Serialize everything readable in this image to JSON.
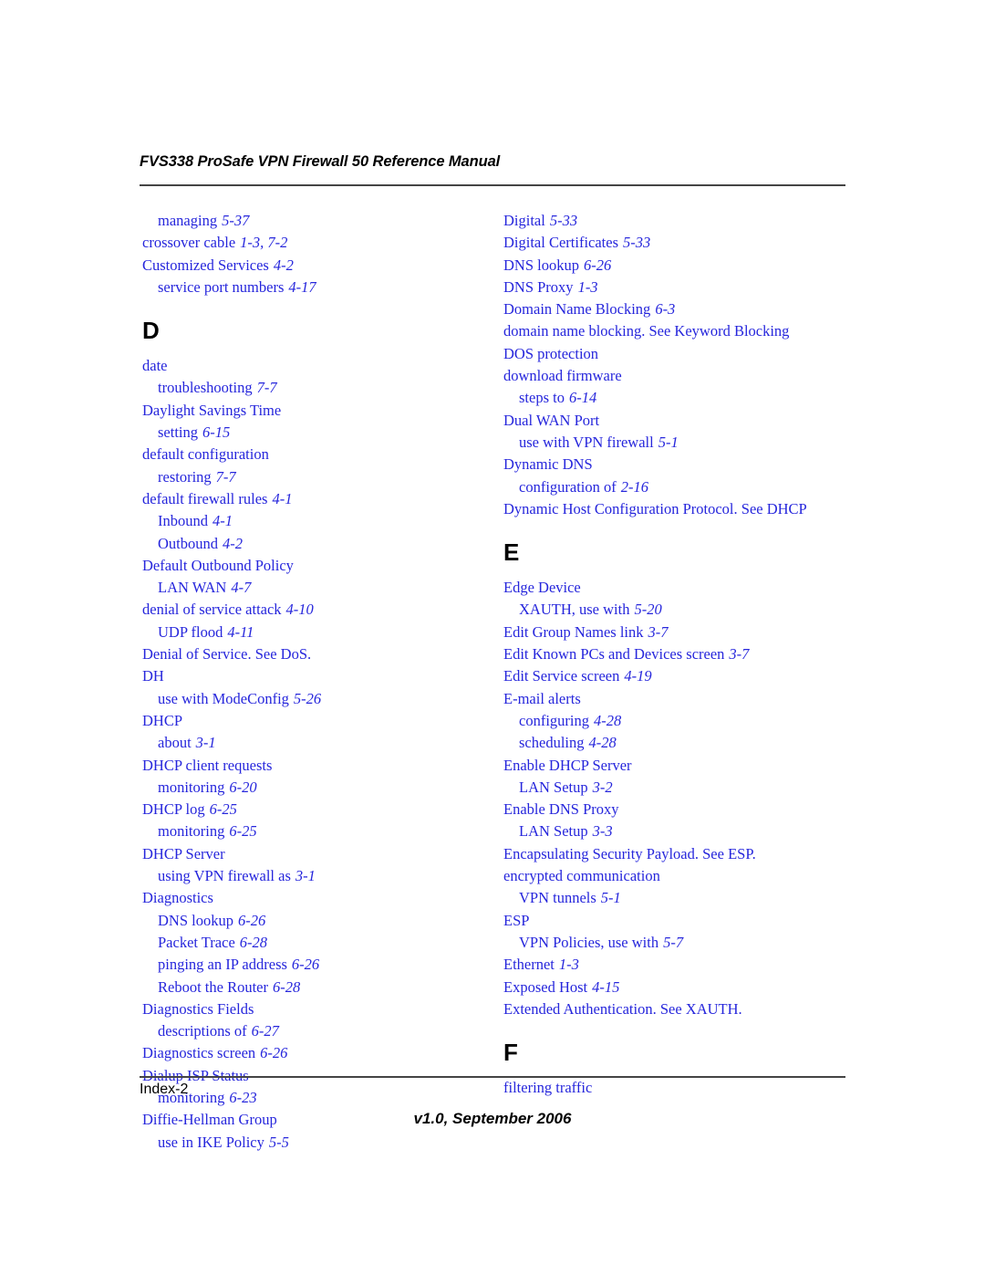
{
  "header": {
    "title": "FVS338 ProSafe VPN Firewall 50 Reference Manual"
  },
  "footer": {
    "folio": "Index-2",
    "version": "v1.0, September 2006"
  },
  "colors": {
    "entry_blue": "#2626DC",
    "rule": "#444444",
    "heading_black": "#000000"
  },
  "columns": [
    {
      "id": "left",
      "blocks": [
        {
          "type": "entries",
          "items": [
            {
              "level": 1,
              "term": "managing",
              "loc": "5-37"
            },
            {
              "level": 0,
              "term": "crossover cable",
              "loc": "1-3, 7-2"
            },
            {
              "level": 0,
              "term": "Customized Services",
              "loc": "4-2"
            },
            {
              "level": 1,
              "term": "service port numbers",
              "loc": "4-17"
            }
          ]
        },
        {
          "type": "alpha",
          "letter": "D"
        },
        {
          "type": "entries",
          "items": [
            {
              "level": 0,
              "term": "date",
              "loc": ""
            },
            {
              "level": 1,
              "term": "troubleshooting",
              "loc": "7-7"
            },
            {
              "level": 0,
              "term": "Daylight Savings Time",
              "loc": ""
            },
            {
              "level": 1,
              "term": "setting",
              "loc": "6-15"
            },
            {
              "level": 0,
              "term": "default configuration",
              "loc": ""
            },
            {
              "level": 1,
              "term": "restoring",
              "loc": "7-7"
            },
            {
              "level": 0,
              "term": "default firewall rules",
              "loc": "4-1"
            },
            {
              "level": 1,
              "term": "Inbound",
              "loc": "4-1"
            },
            {
              "level": 1,
              "term": "Outbound",
              "loc": "4-2"
            },
            {
              "level": 0,
              "term": "Default Outbound Policy",
              "loc": ""
            },
            {
              "level": 1,
              "term": "LAN WAN",
              "loc": "4-7"
            },
            {
              "level": 0,
              "term": "denial of service attack",
              "loc": "4-10"
            },
            {
              "level": 1,
              "term": "UDP flood",
              "loc": "4-11"
            },
            {
              "level": 0,
              "term": "Denial of Service. See DoS.",
              "loc": ""
            },
            {
              "level": 0,
              "term": "DH",
              "loc": ""
            },
            {
              "level": 1,
              "term": "use with ModeConfig",
              "loc": "5-26"
            },
            {
              "level": 0,
              "term": "DHCP",
              "loc": ""
            },
            {
              "level": 1,
              "term": "about",
              "loc": "3-1"
            },
            {
              "level": 0,
              "term": "DHCP client requests",
              "loc": ""
            },
            {
              "level": 1,
              "term": "monitoring",
              "loc": "6-20"
            },
            {
              "level": 0,
              "term": "DHCP log",
              "loc": "6-25"
            },
            {
              "level": 1,
              "term": "monitoring",
              "loc": "6-25"
            },
            {
              "level": 0,
              "term": "DHCP Server",
              "loc": ""
            },
            {
              "level": 1,
              "term": "using VPN firewall as",
              "loc": "3-1"
            },
            {
              "level": 0,
              "term": "Diagnostics",
              "loc": ""
            },
            {
              "level": 1,
              "term": "DNS lookup",
              "loc": "6-26"
            },
            {
              "level": 1,
              "term": "Packet Trace",
              "loc": "6-28"
            },
            {
              "level": 1,
              "term": "pinging an IP address",
              "loc": "6-26"
            },
            {
              "level": 1,
              "term": "Reboot the Router",
              "loc": "6-28"
            },
            {
              "level": 0,
              "term": "Diagnostics Fields",
              "loc": ""
            },
            {
              "level": 1,
              "term": "descriptions of",
              "loc": "6-27"
            },
            {
              "level": 0,
              "term": "Diagnostics screen",
              "loc": "6-26"
            },
            {
              "level": 0,
              "term": "Dialup ISP Status",
              "loc": ""
            },
            {
              "level": 1,
              "term": "monitoring",
              "loc": "6-23"
            },
            {
              "level": 0,
              "term": "Diffie-Hellman Group",
              "loc": ""
            },
            {
              "level": 1,
              "term": "use in IKE Policy",
              "loc": "5-5"
            }
          ]
        }
      ]
    },
    {
      "id": "right",
      "blocks": [
        {
          "type": "entries",
          "items": [
            {
              "level": 0,
              "term": "Digital",
              "loc": "5-33"
            },
            {
              "level": 0,
              "term": "Digital Certificates",
              "loc": "5-33"
            },
            {
              "level": 0,
              "term": "DNS lookup",
              "loc": "6-26"
            },
            {
              "level": 0,
              "term": "DNS Proxy",
              "loc": "1-3"
            },
            {
              "level": 0,
              "term": "Domain Name Blocking",
              "loc": "6-3"
            },
            {
              "level": 0,
              "term": "domain name blocking. See Keyword Blocking",
              "loc": ""
            },
            {
              "level": 0,
              "term": "DOS protection",
              "loc": ""
            },
            {
              "level": 0,
              "term": "download firmware",
              "loc": ""
            },
            {
              "level": 1,
              "term": "steps to",
              "loc": "6-14"
            },
            {
              "level": 0,
              "term": "Dual WAN Port",
              "loc": ""
            },
            {
              "level": 1,
              "term": "use with VPN firewall",
              "loc": "5-1"
            },
            {
              "level": 0,
              "term": "Dynamic DNS",
              "loc": ""
            },
            {
              "level": 1,
              "term": "configuration of",
              "loc": "2-16"
            },
            {
              "level": 0,
              "term": "Dynamic Host Configuration Protocol. See DHCP",
              "loc": ""
            }
          ]
        },
        {
          "type": "alpha",
          "letter": "E"
        },
        {
          "type": "entries",
          "items": [
            {
              "level": 0,
              "term": "Edge Device",
              "loc": ""
            },
            {
              "level": 1,
              "term": "XAUTH, use with",
              "loc": "5-20"
            },
            {
              "level": 0,
              "term": "Edit Group Names link",
              "loc": "3-7"
            },
            {
              "level": 0,
              "term": "Edit Known PCs and Devices screen",
              "loc": "3-7"
            },
            {
              "level": 0,
              "term": "Edit Service screen",
              "loc": "4-19"
            },
            {
              "level": 0,
              "term": "E-mail alerts",
              "loc": ""
            },
            {
              "level": 1,
              "term": "configuring",
              "loc": "4-28"
            },
            {
              "level": 1,
              "term": "scheduling",
              "loc": "4-28"
            },
            {
              "level": 0,
              "term": "Enable DHCP Server",
              "loc": ""
            },
            {
              "level": 1,
              "term": "LAN Setup",
              "loc": "3-2"
            },
            {
              "level": 0,
              "term": "Enable DNS Proxy",
              "loc": ""
            },
            {
              "level": 1,
              "term": "LAN Setup",
              "loc": "3-3"
            },
            {
              "level": 0,
              "term": "Encapsulating Security Payload. See ESP.",
              "loc": ""
            },
            {
              "level": 0,
              "term": "encrypted communication",
              "loc": ""
            },
            {
              "level": 1,
              "term": "VPN tunnels",
              "loc": "5-1"
            },
            {
              "level": 0,
              "term": "ESP",
              "loc": ""
            },
            {
              "level": 1,
              "term": "VPN Policies, use with",
              "loc": "5-7"
            },
            {
              "level": 0,
              "term": "Ethernet",
              "loc": "1-3"
            },
            {
              "level": 0,
              "term": "Exposed Host",
              "loc": "4-15"
            },
            {
              "level": 0,
              "term": "Extended Authentication. See XAUTH.",
              "loc": ""
            }
          ]
        },
        {
          "type": "alpha",
          "letter": "F"
        },
        {
          "type": "entries",
          "items": [
            {
              "level": 0,
              "term": "filtering traffic",
              "loc": ""
            }
          ]
        }
      ]
    }
  ]
}
